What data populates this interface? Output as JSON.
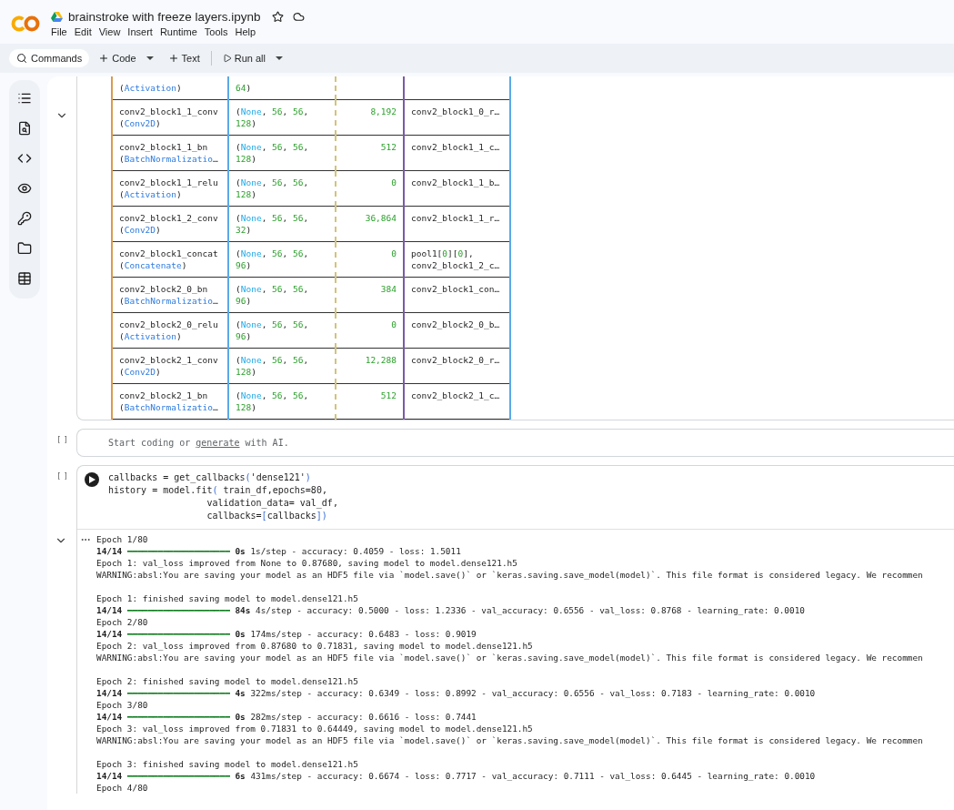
{
  "header": {
    "title": "brainstroke with freeze layers.ipynb",
    "menu": [
      "File",
      "Edit",
      "View",
      "Insert",
      "Runtime",
      "Tools",
      "Help"
    ]
  },
  "toolbar": {
    "search_label": "Commands",
    "buttons": [
      {
        "kind": "add",
        "label": "Code",
        "has_menu": true
      },
      {
        "kind": "add",
        "label": "Text",
        "has_menu": false
      },
      {
        "kind": "run",
        "label": "Run all",
        "has_menu": true
      }
    ]
  },
  "summary_cell": {
    "expanded": true,
    "rows": [
      {
        "layer": [
          "(Activation)"
        ],
        "shape": [
          "64)"
        ],
        "params": "",
        "connected": []
      },
      {
        "layer": [
          "conv2_block1_1_conv",
          "(Conv2D)"
        ],
        "shape": [
          "(None, 56, 56,",
          "128)"
        ],
        "params": "8,192",
        "connected": [
          "conv2_block1_0_r…"
        ]
      },
      {
        "layer": [
          "conv2_block1_1_bn",
          "(BatchNormalizatio…"
        ],
        "shape": [
          "(None, 56, 56,",
          "128)"
        ],
        "params": "512",
        "connected": [
          "conv2_block1_1_c…"
        ]
      },
      {
        "layer": [
          "conv2_block1_1_relu",
          "(Activation)"
        ],
        "shape": [
          "(None, 56, 56,",
          "128)"
        ],
        "params": "0",
        "connected": [
          "conv2_block1_1_b…"
        ]
      },
      {
        "layer": [
          "conv2_block1_2_conv",
          "(Conv2D)"
        ],
        "shape": [
          "(None, 56, 56,",
          "32)"
        ],
        "params": "36,864",
        "connected": [
          "conv2_block1_1_r…"
        ]
      },
      {
        "layer": [
          "conv2_block1_concat",
          "(Concatenate)"
        ],
        "shape": [
          "(None, 56, 56,",
          "96)"
        ],
        "params": "0",
        "connected": [
          "pool1[0][0],",
          "conv2_block1_2_c…"
        ]
      },
      {
        "layer": [
          "conv2_block2_0_bn",
          "(BatchNormalizatio…"
        ],
        "shape": [
          "(None, 56, 56,",
          "96)"
        ],
        "params": "384",
        "connected": [
          "conv2_block1_con…"
        ]
      },
      {
        "layer": [
          "conv2_block2_0_relu",
          "(Activation)"
        ],
        "shape": [
          "(None, 56, 56,",
          "96)"
        ],
        "params": "0",
        "connected": [
          "conv2_block2_0_b…"
        ]
      },
      {
        "layer": [
          "conv2_block2_1_conv",
          "(Conv2D)"
        ],
        "shape": [
          "(None, 56, 56,",
          "128)"
        ],
        "params": "12,288",
        "connected": [
          "conv2_block2_0_r…"
        ]
      },
      {
        "layer": [
          "conv2_block2_1_bn",
          "(BatchNormalizatio…"
        ],
        "shape": [
          "(None, 56, 56,",
          "128)"
        ],
        "params": "512",
        "connected": [
          "conv2_block2_1_c…"
        ]
      }
    ]
  },
  "empty_cell": {
    "execution": "[ ]",
    "placeholder_before": "Start coding or ",
    "link": "generate",
    "placeholder_after": " with AI."
  },
  "code_cell": {
    "execution": "[ ]",
    "lines": [
      "callbacks = get_callbacks('dense121')",
      "history = model.fit( train_df,epochs=80,",
      "                  validation_data= val_df,",
      "                  callbacks=[callbacks])"
    ],
    "output_expanded": true,
    "output": [
      {
        "kind": "text",
        "text": "Epoch 1/80"
      },
      {
        "kind": "progress",
        "steps": "14/14",
        "bar": "━━━━━━━━━━━━━━━━━━━━",
        "time": "0s",
        "text": " 1s/step - accuracy: 0.4059 - loss: 1.5011"
      },
      {
        "kind": "text",
        "text": "Epoch 1: val_loss improved from None to 0.87680, saving model to model.dense121.h5"
      },
      {
        "kind": "text",
        "text": "WARNING:absl:You are saving your model as an HDF5 file via `model.save()` or `keras.saving.save_model(model)`. This file format is considered legacy. We recommen"
      },
      {
        "kind": "blank"
      },
      {
        "kind": "text",
        "text": "Epoch 1: finished saving model to model.dense121.h5"
      },
      {
        "kind": "progress",
        "steps": "14/14",
        "bar": "━━━━━━━━━━━━━━━━━━━━",
        "time": "84s",
        "text": " 4s/step - accuracy: 0.5000 - loss: 1.2336 - val_accuracy: 0.6556 - val_loss: 0.8768 - learning_rate: 0.0010"
      },
      {
        "kind": "text",
        "text": "Epoch 2/80"
      },
      {
        "kind": "progress",
        "steps": "14/14",
        "bar": "━━━━━━━━━━━━━━━━━━━━",
        "time": "0s",
        "text": " 174ms/step - accuracy: 0.6483 - loss: 0.9019"
      },
      {
        "kind": "text",
        "text": "Epoch 2: val_loss improved from 0.87680 to 0.71831, saving model to model.dense121.h5"
      },
      {
        "kind": "text",
        "text": "WARNING:absl:You are saving your model as an HDF5 file via `model.save()` or `keras.saving.save_model(model)`. This file format is considered legacy. We recommen"
      },
      {
        "kind": "blank"
      },
      {
        "kind": "text",
        "text": "Epoch 2: finished saving model to model.dense121.h5"
      },
      {
        "kind": "progress",
        "steps": "14/14",
        "bar": "━━━━━━━━━━━━━━━━━━━━",
        "time": "4s",
        "text": " 322ms/step - accuracy: 0.6349 - loss: 0.8992 - val_accuracy: 0.6556 - val_loss: 0.7183 - learning_rate: 0.0010"
      },
      {
        "kind": "text",
        "text": "Epoch 3/80"
      },
      {
        "kind": "progress",
        "steps": "14/14",
        "bar": "━━━━━━━━━━━━━━━━━━━━",
        "time": "0s",
        "text": " 282ms/step - accuracy: 0.6616 - loss: 0.7441"
      },
      {
        "kind": "text",
        "text": "Epoch 3: val_loss improved from 0.71831 to 0.64449, saving model to model.dense121.h5"
      },
      {
        "kind": "text",
        "text": "WARNING:absl:You are saving your model as an HDF5 file via `model.save()` or `keras.saving.save_model(model)`. This file format is considered legacy. We recommen"
      },
      {
        "kind": "blank"
      },
      {
        "kind": "text",
        "text": "Epoch 3: finished saving model to model.dense121.h5"
      },
      {
        "kind": "progress",
        "steps": "14/14",
        "bar": "━━━━━━━━━━━━━━━━━━━━",
        "time": "6s",
        "text": " 431ms/step - accuracy: 0.6674 - loss: 0.7717 - val_accuracy: 0.7111 - val_loss: 0.6445 - learning_rate: 0.0010"
      },
      {
        "kind": "text",
        "text": "Epoch 4/80"
      }
    ]
  }
}
